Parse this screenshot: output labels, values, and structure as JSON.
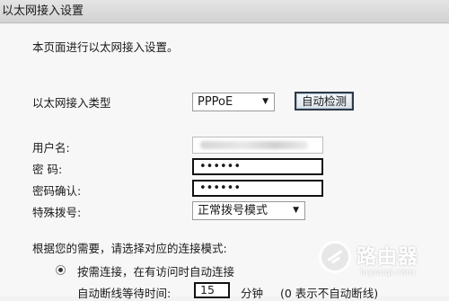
{
  "header": {
    "title": "以太网接入设置"
  },
  "intro": "本页面进行以太网接入设置。",
  "conn_type": {
    "label": "以太网接入类型",
    "value": "PPPoE",
    "detect_button": "自动检测"
  },
  "username": {
    "label": "用户名:",
    "value": ""
  },
  "password": {
    "label": "密 码:",
    "value": "••••••"
  },
  "password_confirm": {
    "label": "密码确认:",
    "value": "••••••"
  },
  "special_dial": {
    "label": "特殊拨号:",
    "value": "正常拨号模式"
  },
  "mode": {
    "prompt": "根据您的需要，请选择对应的连接模式:",
    "on_demand_label": "按需连接，在有访问时自动连接",
    "idle_label": "自动断线等待时间:",
    "idle_value": "15",
    "idle_unit": "分钟",
    "idle_note": "(0 表示不自动断线)"
  },
  "watermark": {
    "name": "路由器",
    "url": "luyouqi.com"
  },
  "icons": {
    "dropdown": "chevron-down-icon",
    "radio": "radio-selected-icon",
    "logo": "router-logo-icon"
  }
}
